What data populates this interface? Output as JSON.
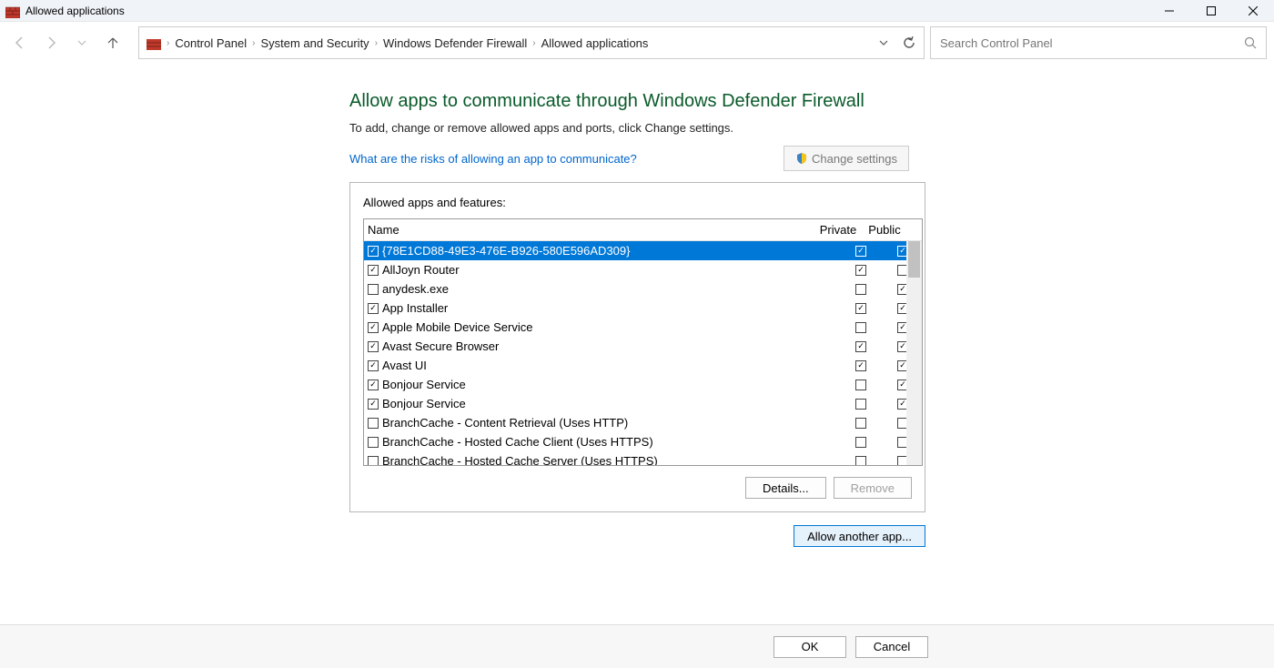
{
  "window": {
    "title": "Allowed applications"
  },
  "breadcrumb": [
    "Control Panel",
    "System and Security",
    "Windows Defender Firewall",
    "Allowed applications"
  ],
  "search": {
    "placeholder": "Search Control Panel"
  },
  "main": {
    "heading": "Allow apps to communicate through Windows Defender Firewall",
    "subtext": "To add, change or remove allowed apps and ports, click Change settings.",
    "risks_link": "What are the risks of allowing an app to communicate?",
    "change_settings": "Change settings",
    "box_label": "Allowed apps and features:",
    "columns": {
      "name": "Name",
      "private": "Private",
      "public": "Public"
    },
    "details": "Details...",
    "remove": "Remove",
    "allow_another": "Allow another app..."
  },
  "apps": [
    {
      "name": "{78E1CD88-49E3-476E-B926-580E596AD309}",
      "enabled": true,
      "private": true,
      "public": true,
      "selected": true
    },
    {
      "name": "AllJoyn Router",
      "enabled": true,
      "private": true,
      "public": false
    },
    {
      "name": "anydesk.exe",
      "enabled": false,
      "private": false,
      "public": true
    },
    {
      "name": "App Installer",
      "enabled": true,
      "private": true,
      "public": true
    },
    {
      "name": "Apple Mobile Device Service",
      "enabled": true,
      "private": false,
      "public": true
    },
    {
      "name": "Avast Secure Browser",
      "enabled": true,
      "private": true,
      "public": true
    },
    {
      "name": "Avast UI",
      "enabled": true,
      "private": true,
      "public": true
    },
    {
      "name": "Bonjour Service",
      "enabled": true,
      "private": false,
      "public": true
    },
    {
      "name": "Bonjour Service",
      "enabled": true,
      "private": false,
      "public": true
    },
    {
      "name": "BranchCache - Content Retrieval (Uses HTTP)",
      "enabled": false,
      "private": false,
      "public": false
    },
    {
      "name": "BranchCache - Hosted Cache Client (Uses HTTPS)",
      "enabled": false,
      "private": false,
      "public": false
    },
    {
      "name": "BranchCache - Hosted Cache Server (Uses HTTPS)",
      "enabled": false,
      "private": false,
      "public": false
    }
  ],
  "footer": {
    "ok": "OK",
    "cancel": "Cancel"
  }
}
